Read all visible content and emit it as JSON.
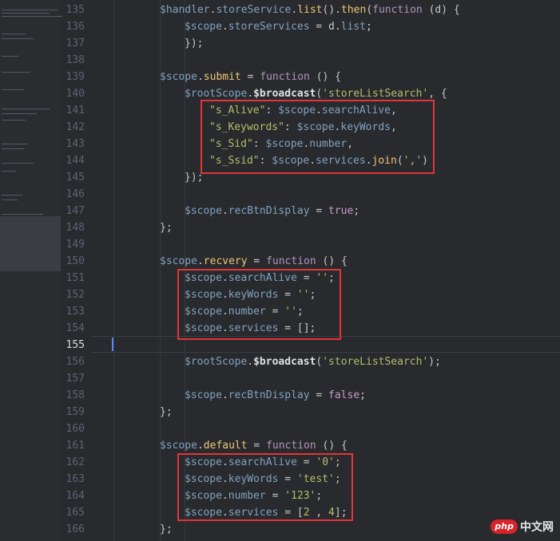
{
  "line_numbers": [
    "135",
    "136",
    "137",
    "138",
    "139",
    "140",
    "141",
    "142",
    "143",
    "144",
    "145",
    "146",
    "147",
    "148",
    "149",
    "150",
    "151",
    "152",
    "153",
    "154",
    "155",
    "156",
    "157",
    "158",
    "159",
    "160",
    "161",
    "162",
    "163",
    "164",
    "165",
    "166"
  ],
  "active_line": "155",
  "code": [
    [
      [
        "var",
        "$handler"
      ],
      [
        "plain",
        "."
      ],
      [
        "var",
        "storeService"
      ],
      [
        "plain",
        "."
      ],
      [
        "fn",
        "list"
      ],
      [
        "plain",
        "()."
      ],
      [
        "fn",
        "then"
      ],
      [
        "plain",
        "("
      ],
      [
        "kw",
        "function"
      ],
      [
        "plain",
        " (d) {"
      ]
    ],
    [
      [
        "var",
        "$scope"
      ],
      [
        "plain",
        "."
      ],
      [
        "var",
        "storeServices"
      ],
      [
        "plain",
        " = d."
      ],
      [
        "var",
        "list"
      ],
      [
        "plain",
        ";"
      ]
    ],
    [
      [
        "plain",
        "});"
      ]
    ],
    [],
    [
      [
        "var",
        "$scope"
      ],
      [
        "plain",
        "."
      ],
      [
        "fn",
        "submit"
      ],
      [
        "plain",
        " = "
      ],
      [
        "kw",
        "function"
      ],
      [
        "plain",
        " () {"
      ]
    ],
    [
      [
        "var",
        "$rootScope"
      ],
      [
        "plain",
        "."
      ],
      [
        "dollar",
        "$broadcast"
      ],
      [
        "plain",
        "("
      ],
      [
        "str",
        "'storeListSearch'"
      ],
      [
        "plain",
        ", {"
      ]
    ],
    [
      [
        "str",
        "\"s_Alive\""
      ],
      [
        "plain",
        ": "
      ],
      [
        "var",
        "$scope"
      ],
      [
        "plain",
        "."
      ],
      [
        "var",
        "searchAlive"
      ],
      [
        "plain",
        ","
      ]
    ],
    [
      [
        "str",
        "\"s_Keywords\""
      ],
      [
        "plain",
        ": "
      ],
      [
        "var",
        "$scope"
      ],
      [
        "plain",
        "."
      ],
      [
        "var",
        "keyWords"
      ],
      [
        "plain",
        ","
      ]
    ],
    [
      [
        "str",
        "\"s_Sid\""
      ],
      [
        "plain",
        ": "
      ],
      [
        "var",
        "$scope"
      ],
      [
        "plain",
        "."
      ],
      [
        "var",
        "number"
      ],
      [
        "plain",
        ","
      ]
    ],
    [
      [
        "str",
        "\"s_Ssid\""
      ],
      [
        "plain",
        ": "
      ],
      [
        "var",
        "$scope"
      ],
      [
        "plain",
        "."
      ],
      [
        "var",
        "services"
      ],
      [
        "plain",
        "."
      ],
      [
        "fn",
        "join"
      ],
      [
        "plain",
        "("
      ],
      [
        "str",
        "','"
      ],
      [
        "plain",
        ")"
      ]
    ],
    [
      [
        "plain",
        "});"
      ]
    ],
    [],
    [
      [
        "var",
        "$scope"
      ],
      [
        "plain",
        "."
      ],
      [
        "var",
        "recBtnDisplay"
      ],
      [
        "plain",
        " = "
      ],
      [
        "bool",
        "true"
      ],
      [
        "plain",
        ";"
      ]
    ],
    [
      [
        "plain",
        "};"
      ]
    ],
    [],
    [
      [
        "var",
        "$scope"
      ],
      [
        "plain",
        "."
      ],
      [
        "fn",
        "recvery"
      ],
      [
        "plain",
        " = "
      ],
      [
        "kw",
        "function"
      ],
      [
        "plain",
        " () {"
      ]
    ],
    [
      [
        "var",
        "$scope"
      ],
      [
        "plain",
        "."
      ],
      [
        "var",
        "searchAlive"
      ],
      [
        "plain",
        " = "
      ],
      [
        "str",
        "''"
      ],
      [
        "plain",
        ";"
      ]
    ],
    [
      [
        "var",
        "$scope"
      ],
      [
        "plain",
        "."
      ],
      [
        "var",
        "keyWords"
      ],
      [
        "plain",
        " = "
      ],
      [
        "str",
        "''"
      ],
      [
        "plain",
        ";"
      ]
    ],
    [
      [
        "var",
        "$scope"
      ],
      [
        "plain",
        "."
      ],
      [
        "var",
        "number"
      ],
      [
        "plain",
        " = "
      ],
      [
        "str",
        "''"
      ],
      [
        "plain",
        ";"
      ]
    ],
    [
      [
        "var",
        "$scope"
      ],
      [
        "plain",
        "."
      ],
      [
        "var",
        "services"
      ],
      [
        "plain",
        " = [];"
      ]
    ],
    [],
    [
      [
        "var",
        "$rootScope"
      ],
      [
        "plain",
        "."
      ],
      [
        "dollar",
        "$broadcast"
      ],
      [
        "plain",
        "("
      ],
      [
        "str",
        "'storeListSearch'"
      ],
      [
        "plain",
        ");"
      ]
    ],
    [],
    [
      [
        "var",
        "$scope"
      ],
      [
        "plain",
        "."
      ],
      [
        "var",
        "recBtnDisplay"
      ],
      [
        "plain",
        " = "
      ],
      [
        "bool",
        "false"
      ],
      [
        "plain",
        ";"
      ]
    ],
    [
      [
        "plain",
        "};"
      ]
    ],
    [],
    [
      [
        "var",
        "$scope"
      ],
      [
        "plain",
        "."
      ],
      [
        "fn",
        "default"
      ],
      [
        "plain",
        " = "
      ],
      [
        "kw",
        "function"
      ],
      [
        "plain",
        " () {"
      ]
    ],
    [
      [
        "var",
        "$scope"
      ],
      [
        "plain",
        "."
      ],
      [
        "var",
        "searchAlive"
      ],
      [
        "plain",
        " = "
      ],
      [
        "str",
        "'0'"
      ],
      [
        "plain",
        ";"
      ]
    ],
    [
      [
        "var",
        "$scope"
      ],
      [
        "plain",
        "."
      ],
      [
        "var",
        "keyWords"
      ],
      [
        "plain",
        " = "
      ],
      [
        "str",
        "'test'"
      ],
      [
        "plain",
        ";"
      ]
    ],
    [
      [
        "var",
        "$scope"
      ],
      [
        "plain",
        "."
      ],
      [
        "var",
        "number"
      ],
      [
        "plain",
        " = "
      ],
      [
        "str",
        "'123'"
      ],
      [
        "plain",
        ";"
      ]
    ],
    [
      [
        "var",
        "$scope"
      ],
      [
        "plain",
        "."
      ],
      [
        "var",
        "services"
      ],
      [
        "plain",
        " = ["
      ],
      [
        "str",
        "2"
      ],
      [
        "plain",
        " , "
      ],
      [
        "str",
        "4"
      ],
      [
        "plain",
        "];"
      ]
    ],
    [
      [
        "plain",
        "};"
      ]
    ]
  ],
  "watermark": {
    "logo": "php",
    "site": "中文网"
  },
  "colors": {
    "highlight_box": "#e0353a",
    "background": "#282a2e",
    "caret": "#528bff"
  }
}
